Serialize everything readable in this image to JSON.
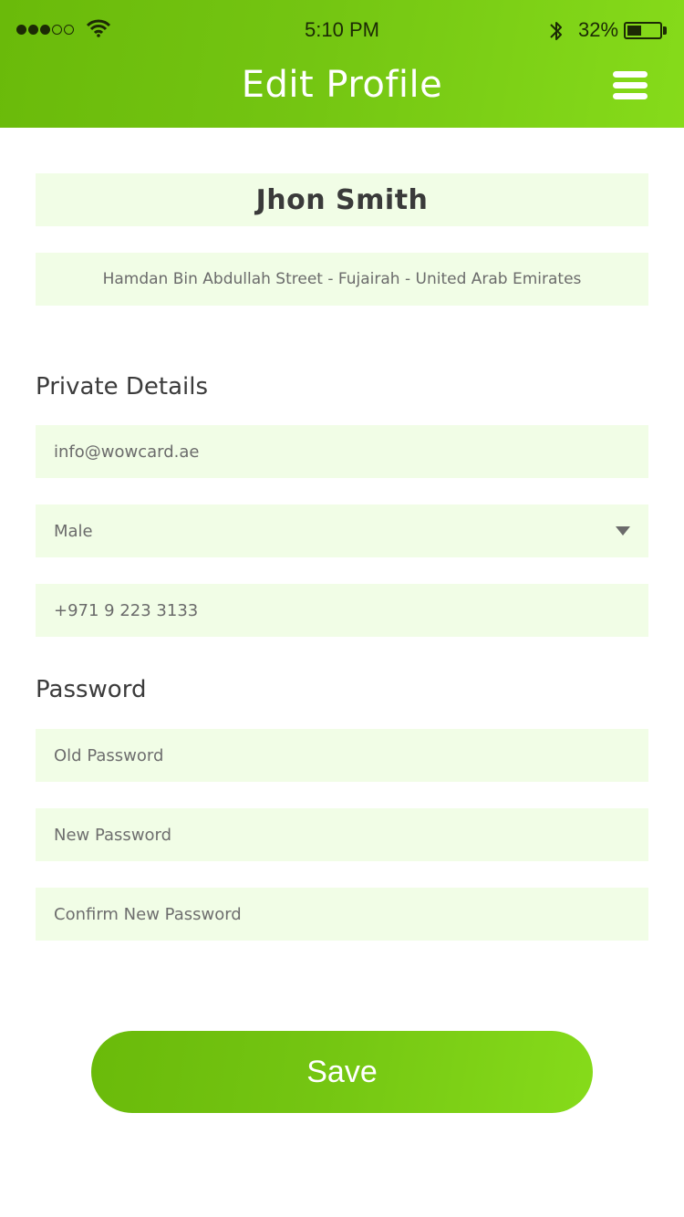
{
  "status_bar": {
    "time": "5:10 PM",
    "battery_percent_text": "32%",
    "battery_level": 0.32,
    "signal_bars_filled": 3,
    "signal_bars_total": 5
  },
  "header": {
    "title": "Edit Profile",
    "menu_icon": "hamburger-menu-icon"
  },
  "profile": {
    "name": "Jhon Smith",
    "address": "Hamdan Bin Abdullah Street - Fujairah - United Arab Emirates"
  },
  "private_details": {
    "title": "Private Details",
    "email": "info@wowcard.ae",
    "gender": "Male",
    "phone": "+971 9 223 3133"
  },
  "password": {
    "title": "Password",
    "old_placeholder": "Old Password",
    "new_placeholder": "New Password",
    "confirm_placeholder": "Confirm New Password"
  },
  "save_label": "Save",
  "colors": {
    "accent": "#74c512",
    "field_bg": "#f1fde6"
  }
}
